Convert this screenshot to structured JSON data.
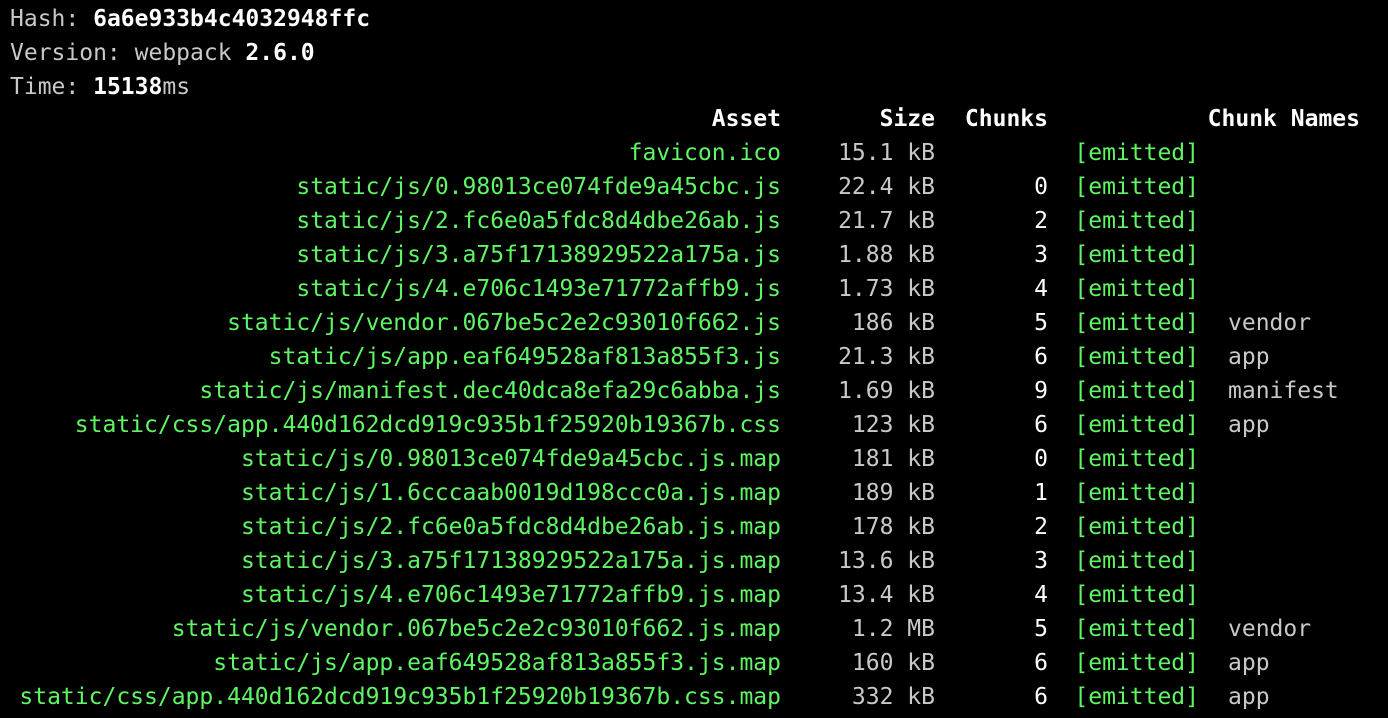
{
  "header": {
    "hash_label": "Hash: ",
    "hash_value": "6a6e933b4c4032948ffc",
    "version_label": "Version: webpack ",
    "version_value": "2.6.0",
    "time_label": "Time: ",
    "time_value": "15138",
    "time_unit": "ms"
  },
  "table": {
    "columns": [
      "Asset",
      "Size",
      "Chunks",
      "",
      "Chunk Names"
    ],
    "rows": [
      {
        "asset": "favicon.ico",
        "size": "15.1 kB",
        "chunk": "",
        "status": "[emitted]",
        "name": ""
      },
      {
        "asset": "static/js/0.98013ce074fde9a45cbc.js",
        "size": "22.4 kB",
        "chunk": "0",
        "status": "[emitted]",
        "name": ""
      },
      {
        "asset": "static/js/2.fc6e0a5fdc8d4dbe26ab.js",
        "size": "21.7 kB",
        "chunk": "2",
        "status": "[emitted]",
        "name": ""
      },
      {
        "asset": "static/js/3.a75f17138929522a175a.js",
        "size": "1.88 kB",
        "chunk": "3",
        "status": "[emitted]",
        "name": ""
      },
      {
        "asset": "static/js/4.e706c1493e71772affb9.js",
        "size": "1.73 kB",
        "chunk": "4",
        "status": "[emitted]",
        "name": ""
      },
      {
        "asset": "static/js/vendor.067be5c2e2c93010f662.js",
        "size": "186 kB",
        "chunk": "5",
        "status": "[emitted]",
        "name": "vendor"
      },
      {
        "asset": "static/js/app.eaf649528af813a855f3.js",
        "size": "21.3 kB",
        "chunk": "6",
        "status": "[emitted]",
        "name": "app"
      },
      {
        "asset": "static/js/manifest.dec40dca8efa29c6abba.js",
        "size": "1.69 kB",
        "chunk": "9",
        "status": "[emitted]",
        "name": "manifest"
      },
      {
        "asset": "static/css/app.440d162dcd919c935b1f25920b19367b.css",
        "size": "123 kB",
        "chunk": "6",
        "status": "[emitted]",
        "name": "app"
      },
      {
        "asset": "static/js/0.98013ce074fde9a45cbc.js.map",
        "size": "181 kB",
        "chunk": "0",
        "status": "[emitted]",
        "name": ""
      },
      {
        "asset": "static/js/1.6cccaab0019d198ccc0a.js.map",
        "size": "189 kB",
        "chunk": "1",
        "status": "[emitted]",
        "name": ""
      },
      {
        "asset": "static/js/2.fc6e0a5fdc8d4dbe26ab.js.map",
        "size": "178 kB",
        "chunk": "2",
        "status": "[emitted]",
        "name": ""
      },
      {
        "asset": "static/js/3.a75f17138929522a175a.js.map",
        "size": "13.6 kB",
        "chunk": "3",
        "status": "[emitted]",
        "name": ""
      },
      {
        "asset": "static/js/4.e706c1493e71772affb9.js.map",
        "size": "13.4 kB",
        "chunk": "4",
        "status": "[emitted]",
        "name": ""
      },
      {
        "asset": "static/js/vendor.067be5c2e2c93010f662.js.map",
        "size": "1.2 MB",
        "chunk": "5",
        "status": "[emitted]",
        "name": "vendor"
      },
      {
        "asset": "static/js/app.eaf649528af813a855f3.js.map",
        "size": "160 kB",
        "chunk": "6",
        "status": "[emitted]",
        "name": "app"
      },
      {
        "asset": "static/css/app.440d162dcd919c935b1f25920b19367b.css.map",
        "size": "332 kB",
        "chunk": "6",
        "status": "[emitted]",
        "name": "app"
      }
    ]
  },
  "colors": {
    "background": "#000000",
    "asset_green": "#5ff565",
    "text_gray": "#c9c9c9",
    "text_white": "#ffffff"
  }
}
